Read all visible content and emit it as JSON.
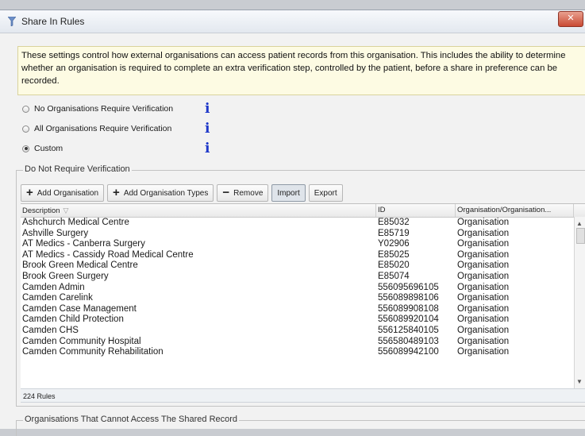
{
  "window": {
    "title": "Share In Rules",
    "close_label": "✕"
  },
  "info_text": "These settings control how external organisations can access patient records from this organisation. This includes the ability to determine whether an organisation is required to complete an extra verification step, controlled by the patient, before a share in preference can be recorded.",
  "options": [
    {
      "label": "No Organisations Require Verification",
      "selected": false
    },
    {
      "label": "All Organisations Require Verification",
      "selected": false
    },
    {
      "label": "Custom",
      "selected": true
    }
  ],
  "info_glyph": "i",
  "group1": {
    "title": "Do Not Require Verification",
    "toolbar": {
      "add_org": "Add Organisation",
      "add_org_types": "Add Organisation Types",
      "remove": "Remove",
      "import": "Import",
      "export": "Export"
    },
    "columns": [
      "Description",
      "ID",
      "Organisation/Organisation..."
    ],
    "rows": [
      {
        "description": "Ashchurch Medical Centre",
        "id": "E85032",
        "type": "Organisation"
      },
      {
        "description": "Ashville Surgery",
        "id": "E85719",
        "type": "Organisation"
      },
      {
        "description": "AT Medics - Canberra Surgery",
        "id": "Y02906",
        "type": "Organisation"
      },
      {
        "description": "AT Medics - Cassidy Road Medical Centre",
        "id": "E85025",
        "type": "Organisation"
      },
      {
        "description": "Brook Green Medical Centre",
        "id": "E85020",
        "type": "Organisation"
      },
      {
        "description": "Brook Green Surgery",
        "id": "E85074",
        "type": "Organisation"
      },
      {
        "description": "Camden Admin",
        "id": "556095696105",
        "type": "Organisation"
      },
      {
        "description": "Camden Carelink",
        "id": "556089898106",
        "type": "Organisation"
      },
      {
        "description": "Camden Case Management",
        "id": "556089908108",
        "type": "Organisation"
      },
      {
        "description": "Camden Child Protection",
        "id": "556089920104",
        "type": "Organisation"
      },
      {
        "description": "Camden CHS",
        "id": "556125840105",
        "type": "Organisation"
      },
      {
        "description": "Camden Community Hospital",
        "id": "556580489103",
        "type": "Organisation"
      },
      {
        "description": "Camden Community Rehabilitation",
        "id": "556089942100",
        "type": "Organisation"
      }
    ],
    "count": "224 Rules"
  },
  "group2": {
    "title": "Organisations That Cannot Access The Shared Record"
  },
  "colors": {
    "info_bg": "#fdfbe3",
    "info_icon": "#1d37c9",
    "close_btn": "#c94a33"
  }
}
